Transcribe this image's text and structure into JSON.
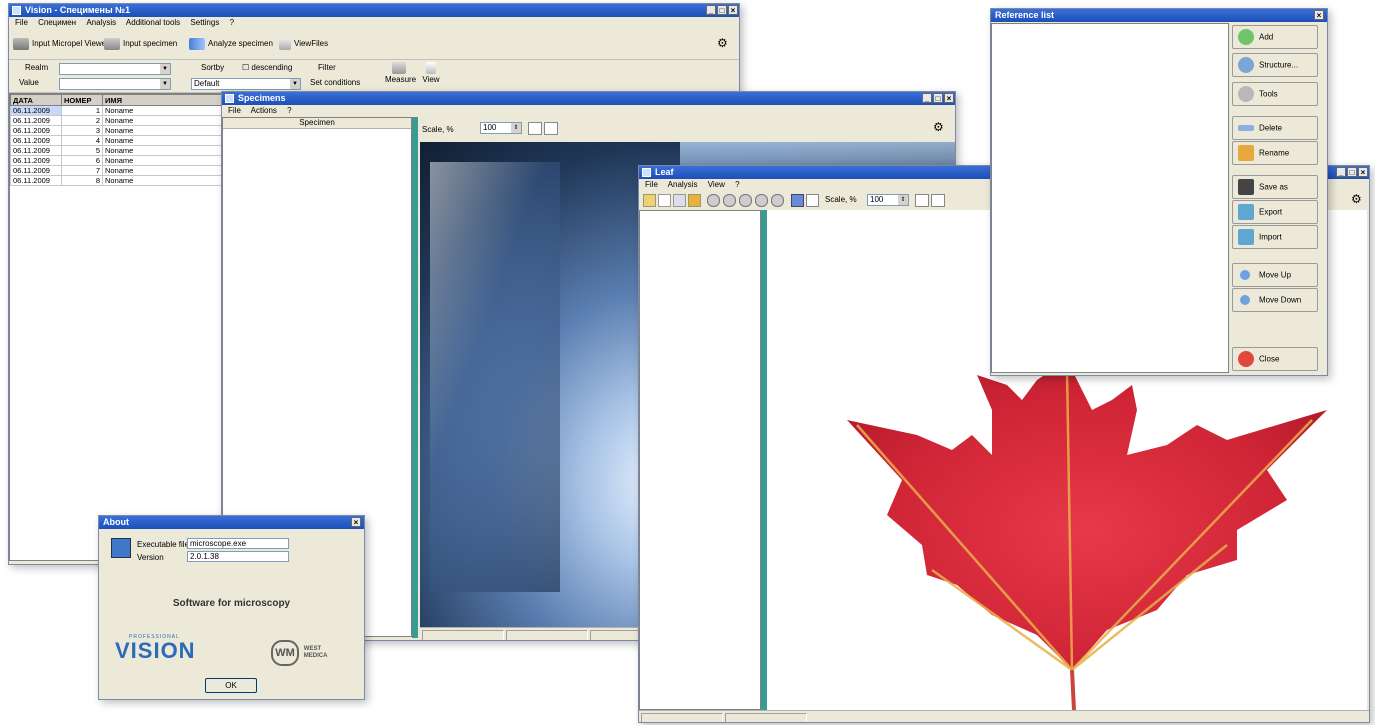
{
  "main_window": {
    "title": "Vision - Специмены №1",
    "menu": [
      "File",
      "Специмен",
      "Analysis",
      "Additional tools",
      "Settings",
      "?"
    ],
    "toolbar": {
      "input_viewer": "Input Micropel Viewer",
      "input_specimen": "Input specimen",
      "analyze_specimen": "Analyze specimen",
      "viewfiles": "ViewFiles"
    },
    "filter": {
      "realm_label": "Realm",
      "value_label": "Value",
      "sortby_label": "Sortby",
      "descending_label": "descending",
      "sort_value": "Default",
      "filter_label": "Filter",
      "set_conditions": "Set conditions",
      "measure": "Measure",
      "view": "View"
    },
    "table": {
      "headers": [
        "ДАТА",
        "НОМЕР",
        "ИМЯ"
      ],
      "rows": [
        [
          "06.11.2009",
          "1",
          "Noname"
        ],
        [
          "06.11.2009",
          "2",
          "Noname"
        ],
        [
          "06.11.2009",
          "3",
          "Noname"
        ],
        [
          "06.11.2009",
          "4",
          "Noname"
        ],
        [
          "06.11.2009",
          "5",
          "Noname"
        ],
        [
          "06.11.2009",
          "6",
          "Noname"
        ],
        [
          "06.11.2009",
          "7",
          "Noname"
        ],
        [
          "06.11.2009",
          "8",
          "Noname"
        ]
      ]
    }
  },
  "specimen_window": {
    "title": "Specimens",
    "menu": [
      "File",
      "Actions",
      "?"
    ],
    "list_header": "Specimen",
    "scale_label": "Scale, %",
    "scale_value": "100"
  },
  "leaf_window": {
    "title": "Leaf",
    "menu": [
      "File",
      "Analysis",
      "View",
      "?"
    ],
    "scale_label": "Scale, %",
    "scale_value": "100"
  },
  "list_window": {
    "title": "Reference list",
    "buttons": [
      "Add",
      "Structure...",
      "Tools",
      "Delete",
      "Rename",
      "Save as",
      "Export",
      "Import",
      "Move Up",
      "Move Down",
      "Close"
    ]
  },
  "about_window": {
    "title": "About",
    "executable_label": "Executable file",
    "executable_value": "microscope.exe",
    "version_label": "Version",
    "version_value": "2.0.1.38",
    "tagline": "Software for microscopy",
    "logo_vision": "VISION",
    "logo_vision_small": "PROFESSIONAL",
    "logo_west": "WEST",
    "logo_medica": "MEDICA",
    "logo_wm": "WM",
    "ok_label": "OK"
  },
  "colors": {
    "title_bar": "#1c4fb8",
    "window_bg": "#ece9d8",
    "splitter": "#3a9a94",
    "leaf_red": "#d8283a",
    "crystal_blue": "#5a7eb0"
  }
}
